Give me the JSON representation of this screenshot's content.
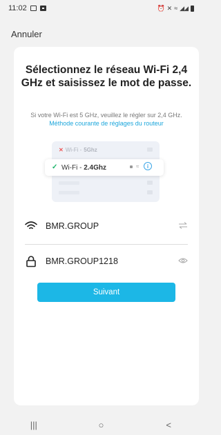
{
  "status_bar": {
    "time": "11:02",
    "signal_text": "◢◢"
  },
  "header": {
    "cancel_label": "Annuler"
  },
  "content": {
    "title": "Sélectionnez le réseau Wi-Fi 2,4 GHz et saisissez le mot de passe.",
    "subtitle": "Si votre Wi-Fi est 5 GHz, veuillez le régler sur 2,4 GHz.",
    "subtitle_link": "Méthode courante de réglages du routeur",
    "illustration": {
      "row_5g_prefix": "Wi-Fi - ",
      "row_5g_band": "5Ghz",
      "row_24_prefix": "Wi-Fi - ",
      "row_24_band": "2.4Ghz"
    },
    "wifi_field": {
      "value": "BMR.GROUP",
      "icon": "wifi-icon",
      "action_icon": "switch-network-icon"
    },
    "password_field": {
      "value": "BMR.GROUP1218",
      "icon": "lock-icon",
      "action_icon": "eye-icon"
    },
    "next_button": "Suivant"
  },
  "nav": {
    "recents": "|||",
    "home": "○",
    "back": "<"
  },
  "colors": {
    "accent": "#1cb7e6",
    "link": "#1ca6db",
    "check": "#1bb46a"
  }
}
